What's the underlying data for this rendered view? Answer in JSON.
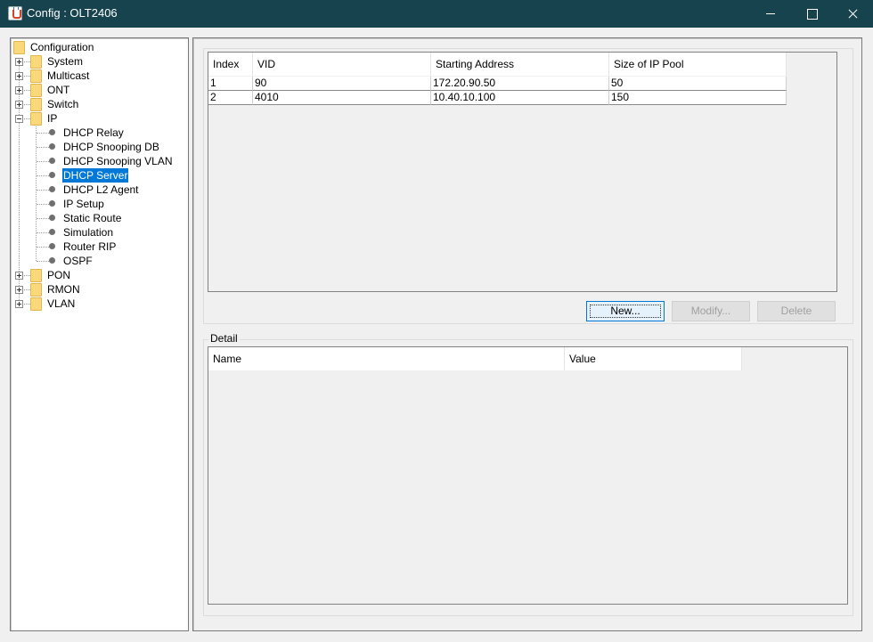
{
  "window": {
    "title": "Config : OLT2406",
    "icon": "java-cup-icon"
  },
  "tree": {
    "root": "Configuration",
    "nodes": [
      {
        "label": "System",
        "expanded": false
      },
      {
        "label": "Multicast",
        "expanded": false
      },
      {
        "label": "ONT",
        "expanded": false
      },
      {
        "label": "Switch",
        "expanded": false
      },
      {
        "label": "IP",
        "expanded": true
      },
      {
        "label": "PON",
        "expanded": false
      },
      {
        "label": "RMON",
        "expanded": false
      },
      {
        "label": "VLAN",
        "expanded": false
      }
    ],
    "ip_children": [
      "DHCP Relay",
      "DHCP Snooping DB",
      "DHCP Snooping VLAN",
      "DHCP Server",
      "DHCP L2 Agent",
      "IP Setup",
      "Static Route",
      "Simulation",
      "Router RIP",
      "OSPF"
    ],
    "selected": "DHCP Server"
  },
  "pool_table": {
    "columns": [
      "Index",
      "VID",
      "Starting Address",
      "Size of IP Pool"
    ],
    "rows": [
      [
        "1",
        "90",
        "172.20.90.50",
        "50"
      ],
      [
        "2",
        "4010",
        "10.40.10.100",
        "150"
      ]
    ]
  },
  "buttons": {
    "new": "New...",
    "modify": "Modify...",
    "delete": "Delete"
  },
  "detail": {
    "title": "Detail",
    "columns": [
      "Name",
      "Value"
    ]
  },
  "colors": {
    "titlebar": "#17434f",
    "selection": "#0078d7",
    "folder": "#fbd97a"
  }
}
